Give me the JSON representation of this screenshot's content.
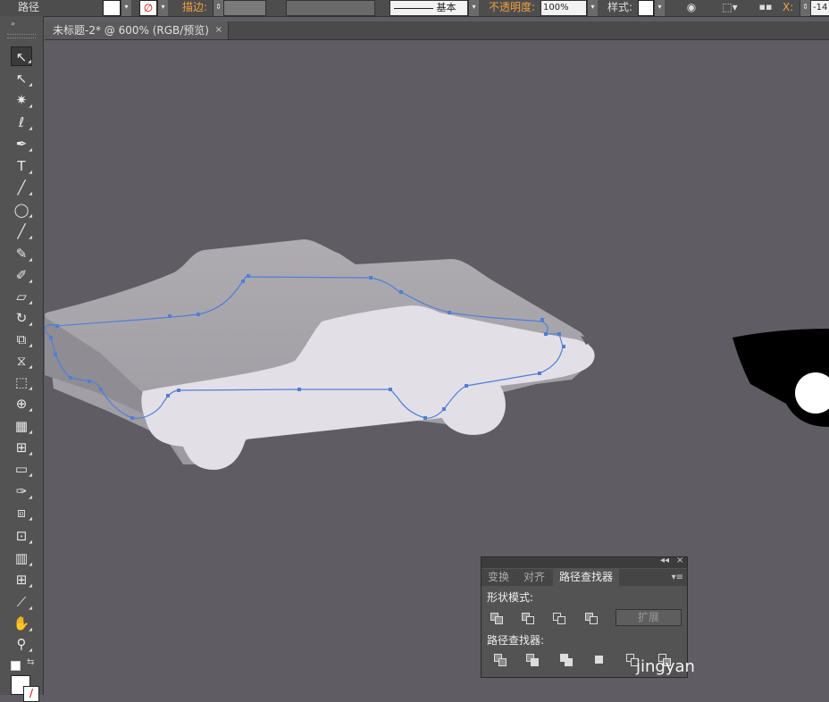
{
  "control_bar": {
    "mode_label": "路径",
    "stroke_label": "描边:",
    "stroke_style": "基本",
    "opacity_label": "不透明度:",
    "opacity_value": "100%",
    "style_label": "样式:",
    "x_label": "X:",
    "x_value": "-14"
  },
  "document_tab": {
    "title": "未标题-2* @ 600% (RGB/预览)",
    "close": "×"
  },
  "tools": [
    {
      "name": "selection-tool",
      "glyph": "↖"
    },
    {
      "name": "direct-selection-tool",
      "glyph": "↖"
    },
    {
      "name": "magic-wand-tool",
      "glyph": "✷"
    },
    {
      "name": "lasso-tool",
      "glyph": "ℓ"
    },
    {
      "name": "pen-tool",
      "glyph": "✒"
    },
    {
      "name": "type-tool",
      "glyph": "T"
    },
    {
      "name": "line-tool",
      "glyph": "╱"
    },
    {
      "name": "ellipse-tool",
      "glyph": "◯"
    },
    {
      "name": "paintbrush-tool",
      "glyph": "╱"
    },
    {
      "name": "pencil-tool",
      "glyph": "✎"
    },
    {
      "name": "blob-brush-tool",
      "glyph": "✐"
    },
    {
      "name": "eraser-tool",
      "glyph": "▱"
    },
    {
      "name": "rotate-tool",
      "glyph": "↻"
    },
    {
      "name": "scale-tool",
      "glyph": "⧉"
    },
    {
      "name": "width-tool",
      "glyph": "⧖"
    },
    {
      "name": "free-transform-tool",
      "glyph": "⬚"
    },
    {
      "name": "shape-builder-tool",
      "glyph": "⊕"
    },
    {
      "name": "perspective-grid-tool",
      "glyph": "▦"
    },
    {
      "name": "mesh-tool",
      "glyph": "⊞"
    },
    {
      "name": "gradient-tool",
      "glyph": "▭"
    },
    {
      "name": "eyedropper-tool",
      "glyph": "✑"
    },
    {
      "name": "blend-tool",
      "glyph": "⧈"
    },
    {
      "name": "symbol-sprayer-tool",
      "glyph": "⊡"
    },
    {
      "name": "column-graph-tool",
      "glyph": "▥"
    },
    {
      "name": "artboard-tool",
      "glyph": "⊞"
    },
    {
      "name": "slice-tool",
      "glyph": "⟋"
    },
    {
      "name": "hand-tool",
      "glyph": "✋"
    },
    {
      "name": "zoom-tool",
      "glyph": "⚲"
    }
  ],
  "pathfinder_panel": {
    "collapse": "◂◂",
    "close": "×",
    "tabs": [
      "变换",
      "对齐",
      "路径查找器"
    ],
    "active_tab": 2,
    "shape_modes_label": "形状模式:",
    "expand_label": "扩展",
    "pathfinders_label": "路径查找器:"
  },
  "watermark": "jingyan",
  "colors": {
    "canvas": "#5f5c63",
    "path": "#4f7fd6",
    "car_light": "#e2e0e6",
    "car_dark": "#a7a5aa"
  }
}
